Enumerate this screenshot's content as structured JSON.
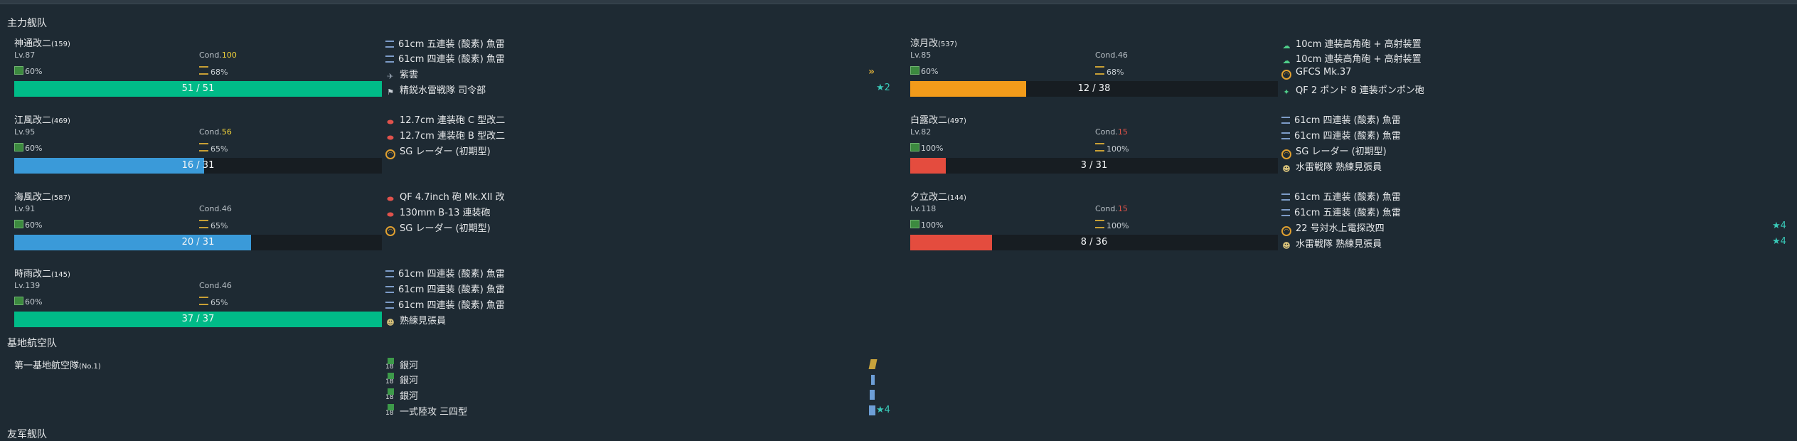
{
  "sections": {
    "main_fleet": "主力舰队",
    "air_base": "基地航空队",
    "support_fleet": "友军舰队"
  },
  "labels": {
    "lv_prefix": "Lv.",
    "cond_prefix": "Cond."
  },
  "left_ships": [
    {
      "name": "神通改二",
      "id": "(159)",
      "lv": "Lv.87",
      "cond_label": "Cond.",
      "cond": "100",
      "fuel": "60%",
      "ammo": "68%",
      "hp": "51 / 51",
      "hp_ratio": 1.0,
      "bar_color": "#00bb88",
      "equips": [
        {
          "icon": "torpedo-icon",
          "name": "61cm 五連装 (酸素) 魚雷"
        },
        {
          "icon": "torpedo-icon",
          "name": "61cm 四連装 (酸素) 魚雷"
        },
        {
          "icon": "seaplane-icon",
          "name": "紫雲"
        },
        {
          "icon": "command-icon",
          "name": "精鋭水雷戦隊 司令部"
        }
      ],
      "extra_mark": "★2"
    },
    {
      "name": "江風改二",
      "id": "(469)",
      "lv": "Lv.95",
      "cond_label": "Cond.",
      "cond": "56",
      "fuel": "60%",
      "ammo": "65%",
      "hp": "16 / 31",
      "hp_ratio": 0.516,
      "bar_color": "#3a9ad9",
      "equips": [
        {
          "icon": "gun-icon",
          "name": "12.7cm 連装砲 C 型改二"
        },
        {
          "icon": "gun-icon",
          "name": "12.7cm 連装砲 B 型改二"
        },
        {
          "icon": "radar-icon",
          "name": "SG レーダー (初期型)"
        }
      ]
    },
    {
      "name": "海風改二",
      "id": "(587)",
      "lv": "Lv.91",
      "cond_label": "Cond.",
      "cond": "46",
      "fuel": "60%",
      "ammo": "65%",
      "hp": "20 / 31",
      "hp_ratio": 0.645,
      "bar_color": "#3a9ad9",
      "equips": [
        {
          "icon": "gun-icon",
          "name": "QF 4.7inch 砲 Mk.XII 改"
        },
        {
          "icon": "gun-icon",
          "name": "130mm B-13 連装砲"
        },
        {
          "icon": "radar-icon",
          "name": "SG レーダー (初期型)"
        }
      ]
    },
    {
      "name": "時雨改二",
      "id": "(145)",
      "lv": "Lv.139",
      "cond_label": "Cond.",
      "cond": "46",
      "fuel": "60%",
      "ammo": "65%",
      "hp": "37 / 37",
      "hp_ratio": 1.0,
      "bar_color": "#00bb88",
      "equips": [
        {
          "icon": "torpedo-icon",
          "name": "61cm 四連装 (酸素) 魚雷"
        },
        {
          "icon": "torpedo-icon",
          "name": "61cm 四連装 (酸素) 魚雷"
        },
        {
          "icon": "torpedo-icon",
          "name": "61cm 四連装 (酸素) 魚雷"
        },
        {
          "icon": "lookout-icon",
          "name": "熟練見張員"
        }
      ]
    }
  ],
  "right_ships": [
    {
      "name": "涼月改",
      "id": "(537)",
      "lv": "Lv.85",
      "cond_label": "Cond.",
      "cond": "46",
      "fuel": "60%",
      "ammo": "68%",
      "hp": "12 / 38",
      "hp_ratio": 0.316,
      "bar_color": "#f29b1a",
      "equips": [
        {
          "icon": "aa-gun-icon",
          "name": "10cm 連装高角砲 + 高射装置"
        },
        {
          "icon": "aa-gun-icon",
          "name": "10cm 連装高角砲 + 高射装置"
        },
        {
          "icon": "radar-icon",
          "name": "GFCS Mk.37"
        },
        {
          "icon": "aa-machine-gun-icon",
          "name": "QF 2 ポンド 8 連装ポンポン砲"
        }
      ]
    },
    {
      "name": "白露改二",
      "id": "(497)",
      "lv": "Lv.82",
      "cond_label": "Cond.",
      "cond": "15",
      "fuel": "100%",
      "ammo": "100%",
      "hp": "3 / 31",
      "hp_ratio": 0.097,
      "bar_color": "#e44c3e",
      "equips": [
        {
          "icon": "torpedo-icon",
          "name": "61cm 四連装 (酸素) 魚雷"
        },
        {
          "icon": "torpedo-icon",
          "name": "61cm 四連装 (酸素) 魚雷"
        },
        {
          "icon": "radar-icon",
          "name": "SG レーダー (初期型)"
        },
        {
          "icon": "lookout-icon",
          "name": "水雷戦隊 熟練見張員"
        }
      ]
    },
    {
      "name": "夕立改二",
      "id": "(144)",
      "lv": "Lv.118",
      "cond_label": "Cond.",
      "cond": "15",
      "fuel": "100%",
      "ammo": "100%",
      "hp": "8 / 36",
      "hp_ratio": 0.222,
      "bar_color": "#e44c3e",
      "equips": [
        {
          "icon": "torpedo-icon",
          "name": "61cm 五連装 (酸素) 魚雷"
        },
        {
          "icon": "torpedo-icon",
          "name": "61cm 五連装 (酸素) 魚雷"
        },
        {
          "icon": "radar-icon",
          "name": "22 号対水上電探改四"
        },
        {
          "icon": "lookout-icon",
          "name": "水雷戦隊 熟練見張員"
        }
      ],
      "stars": [
        "★4",
        "★4"
      ]
    }
  ],
  "air_base": {
    "name": "第一基地航空隊",
    "no": "(No.1)",
    "slots": [
      {
        "count": "18",
        "name": "銀河"
      },
      {
        "count": "18",
        "name": "銀河"
      },
      {
        "count": "18",
        "name": "銀河"
      },
      {
        "count": "18",
        "name": "一式陸攻 三四型"
      }
    ],
    "last_star": "★4"
  },
  "colors": {
    "green": "#00bb88",
    "blue": "#3a9ad9",
    "orange": "#f29b1a",
    "red": "#e44c3e",
    "cond_yellow": "#f1d23a",
    "cond_red": "#e0534a"
  }
}
